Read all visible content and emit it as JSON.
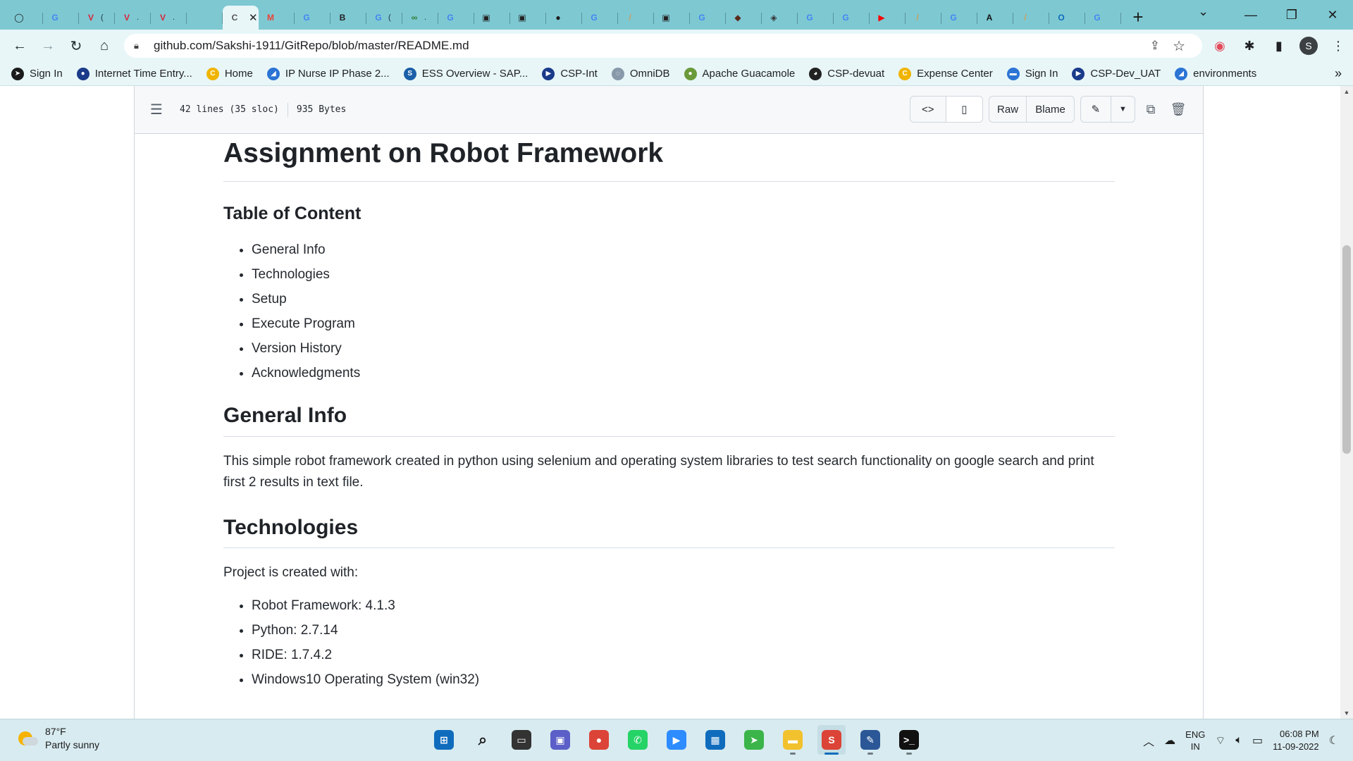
{
  "browser": {
    "tabs": [
      {
        "icon": "circle-icon",
        "glyph": "◯",
        "color": "#1b1b1b",
        "label": ""
      },
      {
        "icon": "google-icon",
        "glyph": "G",
        "color": "#4285f4",
        "label": ""
      },
      {
        "icon": "v-logo-icon",
        "glyph": "V",
        "color": "#d9263c",
        "label": "("
      },
      {
        "icon": "v-logo-icon",
        "glyph": "V",
        "color": "#d9263c",
        "label": "."
      },
      {
        "icon": "v-logo-icon",
        "glyph": "V",
        "color": "#d9263c",
        "label": "."
      },
      {
        "icon": "blank-page-icon",
        "glyph": "",
        "color": "#9cc",
        "label": ""
      },
      {
        "icon": "tab-active",
        "glyph": "C",
        "color": "#555",
        "label": "",
        "active": true
      },
      {
        "icon": "gmail-icon",
        "glyph": "M",
        "color": "#ea4335",
        "label": ""
      },
      {
        "icon": "google-icon",
        "glyph": "G",
        "color": "#4285f4",
        "label": ""
      },
      {
        "icon": "bth-icon",
        "glyph": "B",
        "color": "#222",
        "label": ""
      },
      {
        "icon": "google-icon",
        "glyph": "G",
        "color": "#4285f4",
        "label": "("
      },
      {
        "icon": "infinity-icon",
        "glyph": "∞",
        "color": "#2e7d32",
        "label": "."
      },
      {
        "icon": "google-icon",
        "glyph": "G",
        "color": "#4285f4",
        "label": ""
      },
      {
        "icon": "app-grid-icon",
        "glyph": "▣",
        "color": "#222",
        "label": ""
      },
      {
        "icon": "app-grid-icon",
        "glyph": "▣",
        "color": "#222",
        "label": ""
      },
      {
        "icon": "github-icon",
        "glyph": "●",
        "color": "#1b1b1b",
        "label": ""
      },
      {
        "icon": "google-icon",
        "glyph": "G",
        "color": "#4285f4",
        "label": ""
      },
      {
        "icon": "feather-icon",
        "glyph": "/",
        "color": "#c8a060",
        "label": ""
      },
      {
        "icon": "app-grid-icon",
        "glyph": "▣",
        "color": "#222",
        "label": ""
      },
      {
        "icon": "google-icon",
        "glyph": "G",
        "color": "#4285f4",
        "label": ""
      },
      {
        "icon": "cube-icon",
        "glyph": "◆",
        "color": "#5a2a1a",
        "label": ""
      },
      {
        "icon": "diamond-icon",
        "glyph": "◈",
        "color": "#333",
        "label": ""
      },
      {
        "icon": "google-icon",
        "glyph": "G",
        "color": "#4285f4",
        "label": ""
      },
      {
        "icon": "google-icon",
        "glyph": "G",
        "color": "#4285f4",
        "label": ""
      },
      {
        "icon": "youtube-icon",
        "glyph": "▶",
        "color": "#ff0000",
        "label": ""
      },
      {
        "icon": "feather-icon",
        "glyph": "/",
        "color": "#c8a060",
        "label": ""
      },
      {
        "icon": "google-icon",
        "glyph": "G",
        "color": "#4285f4",
        "label": ""
      },
      {
        "icon": "a-logo-icon",
        "glyph": "A",
        "color": "#111",
        "label": ""
      },
      {
        "icon": "feather-icon",
        "glyph": "/",
        "color": "#c8a060",
        "label": ""
      },
      {
        "icon": "outlook-icon",
        "glyph": "O",
        "color": "#0f6cbd",
        "label": ""
      },
      {
        "icon": "google-icon",
        "glyph": "G",
        "color": "#4285f4",
        "label": ""
      }
    ],
    "new_tab": "+",
    "url": "github.com/Sakshi-1911/GitRepo/blob/master/README.md",
    "profile_initial": "S",
    "bookmarks": [
      {
        "label": "Sign In",
        "color": "#1b1b1b",
        "glyph": "➤"
      },
      {
        "label": "Internet Time Entry...",
        "color": "#1a3a8a",
        "glyph": "●"
      },
      {
        "label": "Home",
        "color": "#f0b400",
        "glyph": "C"
      },
      {
        "label": "IP Nurse IP Phase 2...",
        "color": "#2b74d4",
        "glyph": "◢"
      },
      {
        "label": "ESS Overview - SAP...",
        "color": "#1a5fa8",
        "glyph": "S"
      },
      {
        "label": "CSP-Int",
        "color": "#1a3a8a",
        "glyph": "▶"
      },
      {
        "label": "OmniDB",
        "color": "#8899aa",
        "glyph": "◌"
      },
      {
        "label": "Apache Guacamole",
        "color": "#6a9a3a",
        "glyph": "●"
      },
      {
        "label": "CSP-devuat",
        "color": "#222",
        "glyph": "◕"
      },
      {
        "label": "Expense Center",
        "color": "#f0b400",
        "glyph": "C"
      },
      {
        "label": "Sign In",
        "color": "#2b74d4",
        "glyph": "▬"
      },
      {
        "label": "CSP-Dev_UAT",
        "color": "#1a3a8a",
        "glyph": "▶"
      },
      {
        "label": "environments",
        "color": "#2b74d4",
        "glyph": "◢"
      }
    ],
    "bookmarks_more": "»"
  },
  "file_header": {
    "lines": "42 lines (35 sloc)",
    "size": "935 Bytes",
    "raw_label": "Raw",
    "blame_label": "Blame"
  },
  "readme": {
    "title": "Assignment on Robot Framework",
    "toc_heading": "Table of Content",
    "toc": [
      "General Info",
      "Technologies",
      "Setup",
      "Execute Program",
      "Version History",
      "Acknowledgments"
    ],
    "general_info_heading": "General Info",
    "general_info_text": "This simple robot framework created in python using selenium and operating system libraries to test search functionality on google search and print first 2 results in text file.",
    "technologies_heading": "Technologies",
    "technologies_intro": "Project is created with:",
    "technologies": [
      "Robot Framework: 4.1.3",
      "Python: 2.7.14",
      "RIDE: 1.7.4.2",
      "Windows10 Operating System (win32)"
    ]
  },
  "taskbar": {
    "temperature": "87°F",
    "condition": "Partly sunny",
    "apps": [
      {
        "name": "start-icon",
        "glyph": "⊞",
        "bg": "#0f6cbd",
        "running": false
      },
      {
        "name": "search-icon",
        "glyph": "⌕",
        "bg": "#d8ebf0",
        "running": false
      },
      {
        "name": "task-view-icon",
        "glyph": "▭",
        "bg": "#333",
        "running": false
      },
      {
        "name": "teams-chat-icon",
        "glyph": "▣",
        "bg": "#5b5fc7",
        "running": false
      },
      {
        "name": "chrome-icon",
        "glyph": "●",
        "bg": "#db4437",
        "running": false
      },
      {
        "name": "whatsapp-icon",
        "glyph": "✆",
        "bg": "#25d366",
        "running": false
      },
      {
        "name": "zoom-icon",
        "glyph": "▶",
        "bg": "#2d8cff",
        "running": false
      },
      {
        "name": "store-icon",
        "glyph": "▦",
        "bg": "#0f6cbd",
        "running": false
      },
      {
        "name": "send-icon",
        "glyph": "➤",
        "bg": "#3bb54a",
        "running": false
      },
      {
        "name": "file-explorer-icon",
        "glyph": "▬",
        "bg": "#f2c12e",
        "running": true
      },
      {
        "name": "chrome-profile-icon",
        "glyph": "S",
        "bg": "#db4437",
        "running": true,
        "active": true
      },
      {
        "name": "notepad-icon",
        "glyph": "✎",
        "bg": "#2b5797",
        "running": true
      },
      {
        "name": "terminal-icon",
        "glyph": ">_",
        "bg": "#111",
        "running": true
      }
    ],
    "lang_top": "ENG",
    "lang_bottom": "IN",
    "time": "06:08 PM",
    "date": "11-09-2022"
  }
}
